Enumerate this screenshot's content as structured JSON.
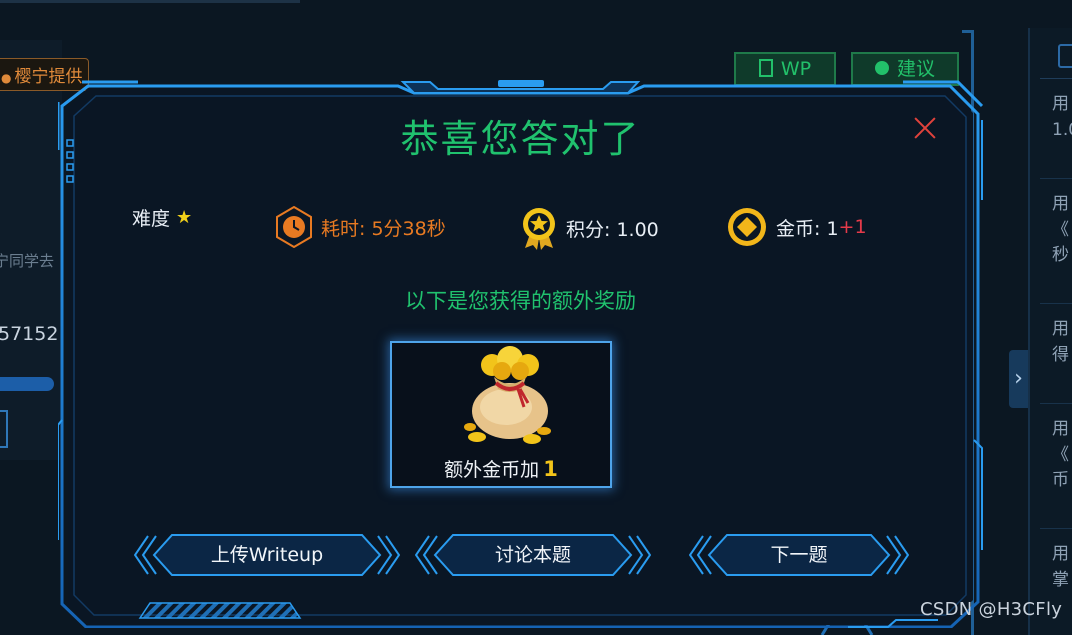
{
  "background": {
    "provider_tag": "樱宁提供",
    "student_text": "宁同学去",
    "number_text": "57152",
    "buttons": {
      "wp_label": "WP",
      "suggest_label": "建议"
    },
    "right_items": [
      "用",
      "1.0",
      "用",
      "《",
      "秒",
      "用",
      "得",
      "用",
      "《",
      "币",
      "用",
      "掌"
    ],
    "arrow": "›"
  },
  "modal": {
    "title": "恭喜您答对了",
    "stats": {
      "difficulty_label": "难度",
      "difficulty_stars": "★",
      "time_text": "耗时: 5分38秒",
      "score_text": "积分: 1.00",
      "coin_text": "金币: 1",
      "coin_bonus": "+1"
    },
    "reward_label": "以下是您获得的额外奖励",
    "reward": {
      "text": "额外金币加",
      "amount": "1"
    },
    "buttons": {
      "upload": "上传Writeup",
      "discuss": "讨论本题",
      "next": "下一题"
    }
  },
  "watermark": "CSDN @H3CFly",
  "colors": {
    "accent_green": "#20c26e",
    "frame_blue": "#1e7fd0",
    "time_orange": "#e87a22",
    "bonus_red": "#e53a4a",
    "gold": "#f2c41a",
    "close_red": "#e0423c"
  }
}
